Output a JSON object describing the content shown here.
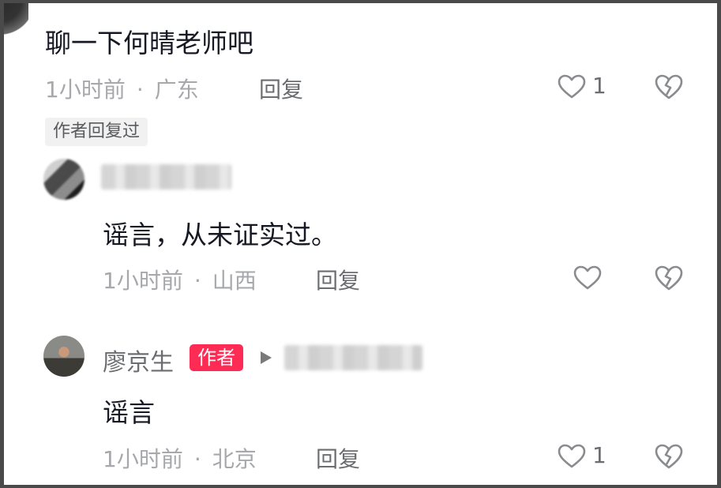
{
  "comment": {
    "text": "聊一下何晴老师吧",
    "time": "1小时前",
    "location": "广东",
    "reply_label": "回复",
    "like_count": "1",
    "author_replied_tag": "作者回复过"
  },
  "replies": [
    {
      "text": "谣言，从未证实过。",
      "time": "1小时前",
      "location": "山西",
      "reply_label": "回复",
      "like_count": ""
    },
    {
      "username": "廖京生",
      "badge": "作者",
      "text": "谣言",
      "time": "1小时前",
      "location": "北京",
      "reply_label": "回复",
      "like_count": "1"
    }
  ],
  "icons": {
    "like": "heart-outline-icon",
    "dislike": "broken-heart-icon",
    "play": "play-triangle-icon"
  },
  "colors": {
    "author_badge": "#fe2c55",
    "text": "#161823",
    "meta": "#a7a8ab"
  }
}
